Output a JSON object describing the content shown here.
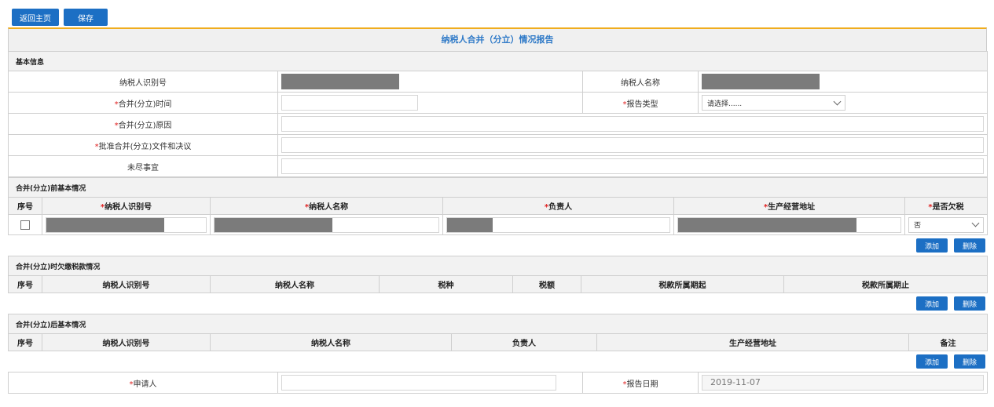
{
  "toolbar": {
    "back_label": "返回主页",
    "save_label": "保存"
  },
  "report": {
    "title": "纳税人合并（分立）情况报告"
  },
  "basic": {
    "section": "基本信息",
    "taxpayer_id_label": "纳税人识别号",
    "taxpayer_name_label": "纳税人名称",
    "merge_time_label": "合并(分立)时间",
    "report_type_label": "报告类型",
    "report_type_value": "请选择......",
    "merge_reason_label": "合并(分立)原因",
    "approval_doc_label": "批准合并(分立)文件和决议",
    "pending_label": "未尽事宜",
    "required_mark": "*"
  },
  "before": {
    "section": "合并(分立)前基本情况",
    "cols": [
      "序号",
      "纳税人识别号",
      "纳税人名称",
      "负责人",
      "生产经营地址",
      "是否欠税"
    ],
    "owes_tax_value": "否"
  },
  "arrears": {
    "section": "合并(分立)时欠缴税款情况",
    "cols": [
      "序号",
      "纳税人识别号",
      "纳税人名称",
      "税种",
      "税额",
      "税款所属期起",
      "税款所属期止"
    ]
  },
  "after": {
    "section": "合并(分立)后基本情况",
    "cols": [
      "序号",
      "纳税人识别号",
      "纳税人名称",
      "负责人",
      "生产经营地址",
      "备注"
    ]
  },
  "actions": {
    "add_label": "添加",
    "delete_label": "删除"
  },
  "footer": {
    "applicant_label": "申请人",
    "report_date_label": "报告日期",
    "report_date_value": "2019-11-07"
  }
}
